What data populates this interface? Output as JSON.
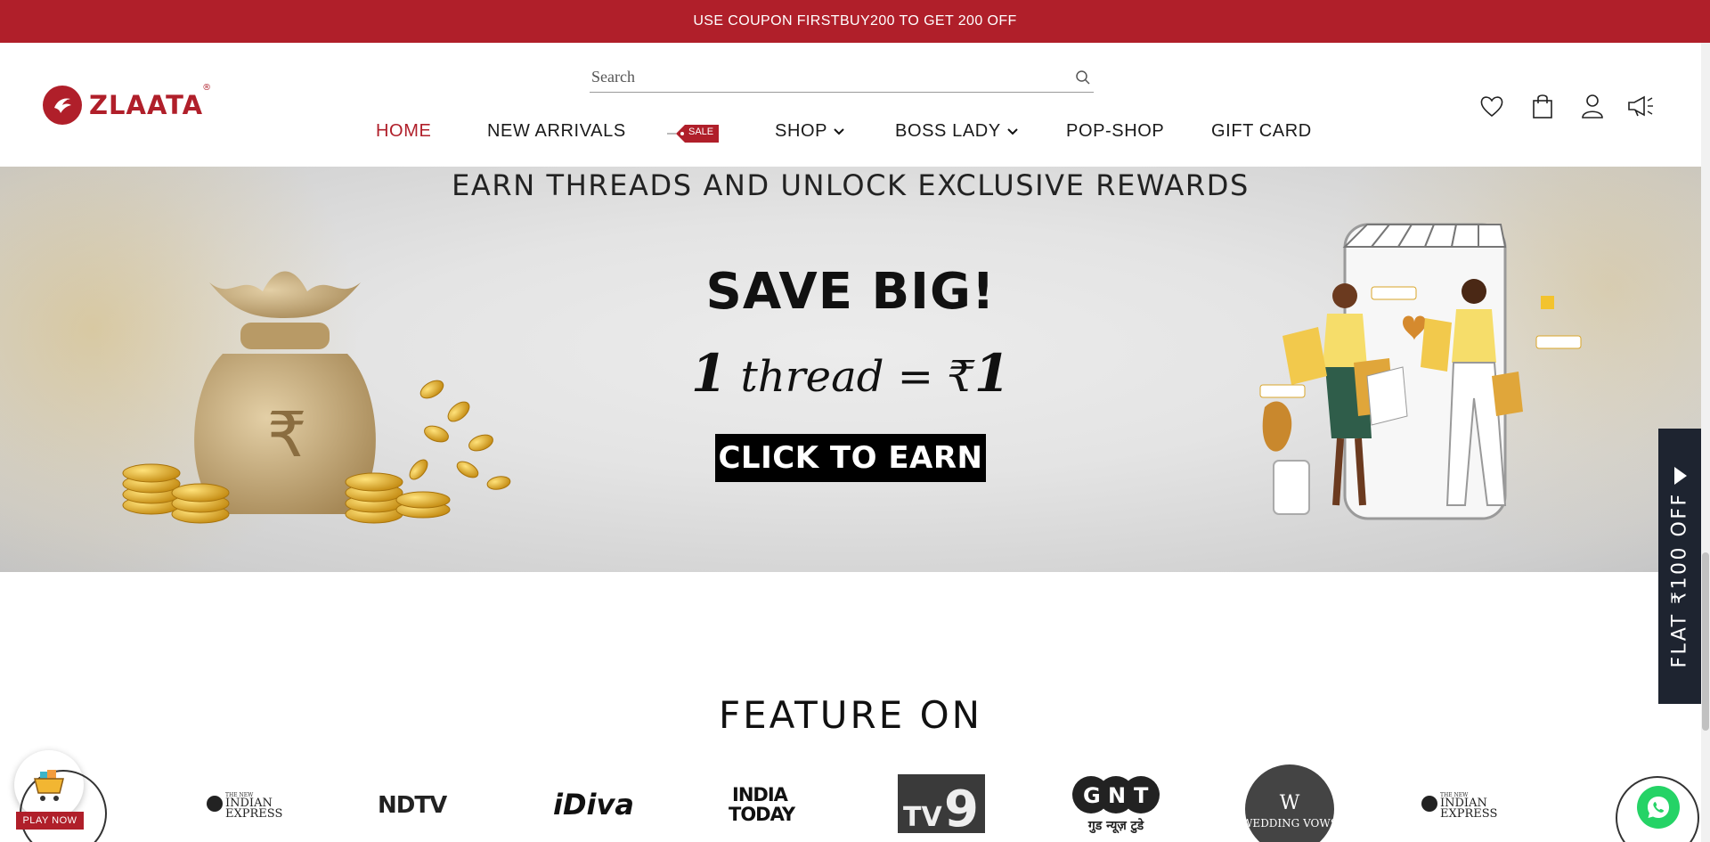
{
  "announcement": {
    "text": "USE COUPON FIRSTBUY200 TO GET 200 OFF"
  },
  "brand": {
    "name": "ZLAATA",
    "registered": "®"
  },
  "search": {
    "placeholder": "Search"
  },
  "nav": {
    "items": [
      {
        "label": "HOME",
        "active": true
      },
      {
        "label": "NEW ARRIVALS"
      },
      {
        "label": "SHOP",
        "dropdown": true
      },
      {
        "label": "BOSS LADY",
        "dropdown": true
      },
      {
        "label": "POP-SHOP"
      },
      {
        "label": "GIFT CARD"
      }
    ],
    "sale_tag": "SALE"
  },
  "header_icons": [
    "heart-icon",
    "bag-icon",
    "user-icon",
    "megaphone-icon"
  ],
  "banner": {
    "headline": "EARN THREADS AND UNLOCK EXCLUSIVE REWARDS",
    "save": "SAVE BIG!",
    "eq_num1": "1",
    "eq_word": "thread",
    "eq_sign": "=",
    "eq_currency": "₹",
    "eq_num2": "1",
    "cta": "CLICK TO EARN"
  },
  "side_tab": {
    "label": "FLAT ₹100 OFF"
  },
  "feature": {
    "title": "FEATURE ON",
    "logos": [
      "INDIAN EXPRESS",
      "NDTV",
      "iDiva",
      "INDIA TODAY",
      "TV9",
      "GNT",
      "WEDDING VOWS",
      "INDIAN EXPRESS"
    ],
    "gnt_sub": "गुड न्यूज़ टुडे",
    "ie_small": "THE NEW",
    "tv9_sub": "9"
  },
  "play": {
    "label": "PLAY NOW"
  },
  "colors": {
    "brand_red": "#b01f2a",
    "whatsapp": "#25d366",
    "side_tab_bg": "#1e2430"
  }
}
